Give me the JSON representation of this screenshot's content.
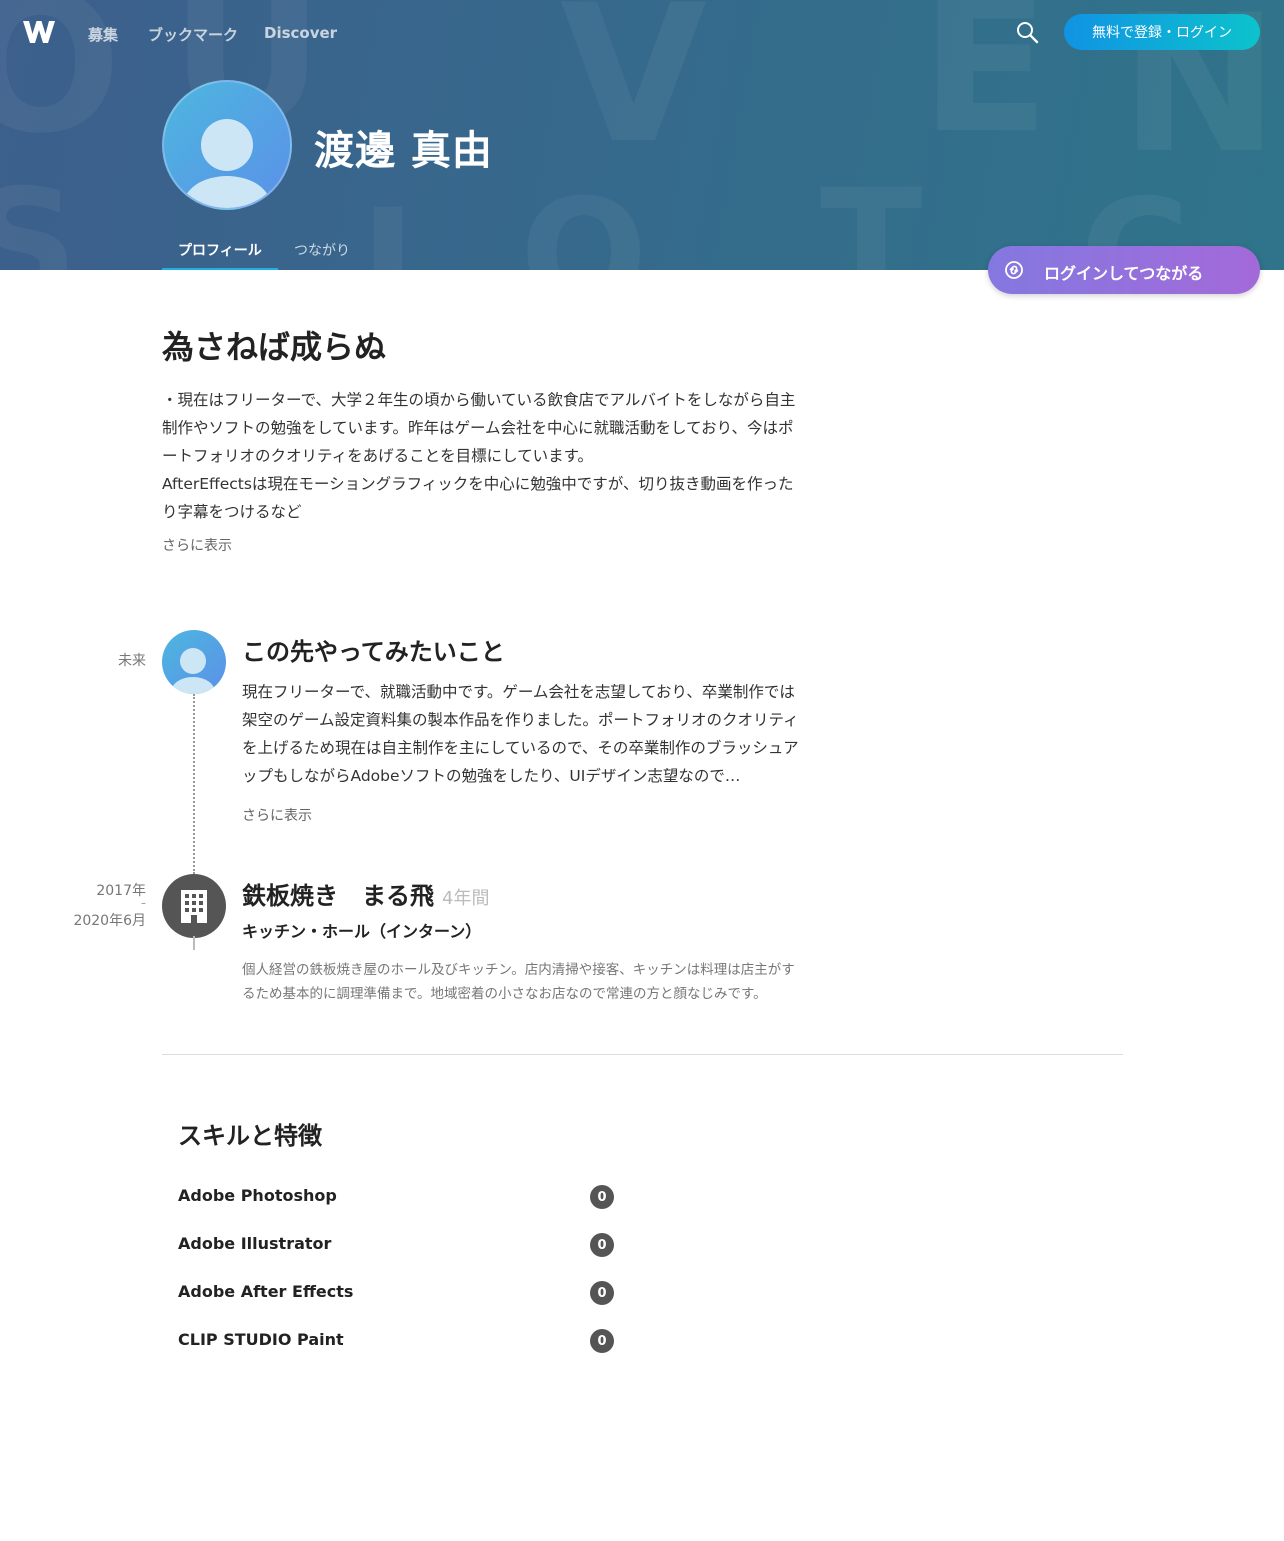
{
  "colors": {
    "accent": "#1cb0e6",
    "signup_gradient": [
      "#1193e3",
      "#0cc3cc"
    ],
    "connect_gradient": [
      "#8478e0",
      "#a36ad9"
    ],
    "header_bg": "#36698c",
    "badge": "#555555"
  },
  "nav": {
    "items": [
      "募集",
      "ブックマーク",
      "Discover"
    ],
    "signup_label": "無料で登録・ログイン",
    "search_icon": "search-icon",
    "logo_icon": "w-logo-icon"
  },
  "profile": {
    "name": "渡邊 真由",
    "tabs": [
      "プロフィール",
      "つながり"
    ],
    "connect_label": "ログインしてつながる"
  },
  "intro": {
    "headline": "為さねば成らぬ",
    "text": "・現在はフリーターで、大学２年生の頃から働いている飲食店でアルバイトをしながら自主制作やソフトの勉強をしています。昨年はゲーム会社を中心に就職活動をしており、今はポートフォリオのクオリティをあげることを目標にしています。\nAfterEffectsは現在モーショングラフィックを中心に勉強中ですが、切り抜き動画を作ったり字幕をつけるなど",
    "more_label": "さらに表示"
  },
  "timeline": {
    "future": {
      "date": "未来",
      "title": "この先やってみたいこと",
      "body": "現在フリーターで、就職活動中です。ゲーム会社を志望しており、卒業制作では架空のゲーム設定資料集の製本作品を作りました。ポートフォリオのクオリティを上げるため現在は自主制作を主にしているので、その卒業制作のブラッシュアップもしながらAdobeソフトの勉強をしたり、UIデザイン志望なので…",
      "more_label": "さらに表示"
    },
    "job": {
      "date_start": "2017年",
      "date_sep": "–",
      "date_end": "2020年6月",
      "company": "鉄板焼き　まる飛",
      "duration": "4年間",
      "role": "キッチン・ホール（インターン）",
      "description": "個人経営の鉄板焼き屋のホール及びキッチン。店内清掃や接客、キッチンは料理は店主がするため基本的に調理準備まで。地域密着の小さなお店なので常連の方と顔なじみです。",
      "icon": "building-icon"
    }
  },
  "skills": {
    "title": "スキルと特徴",
    "items": [
      {
        "name": "Adobe Photoshop",
        "count": "0"
      },
      {
        "name": "Adobe Illustrator",
        "count": "0"
      },
      {
        "name": "Adobe After Effects",
        "count": "0"
      },
      {
        "name": "CLIP STUDIO Paint",
        "count": "0"
      }
    ]
  }
}
